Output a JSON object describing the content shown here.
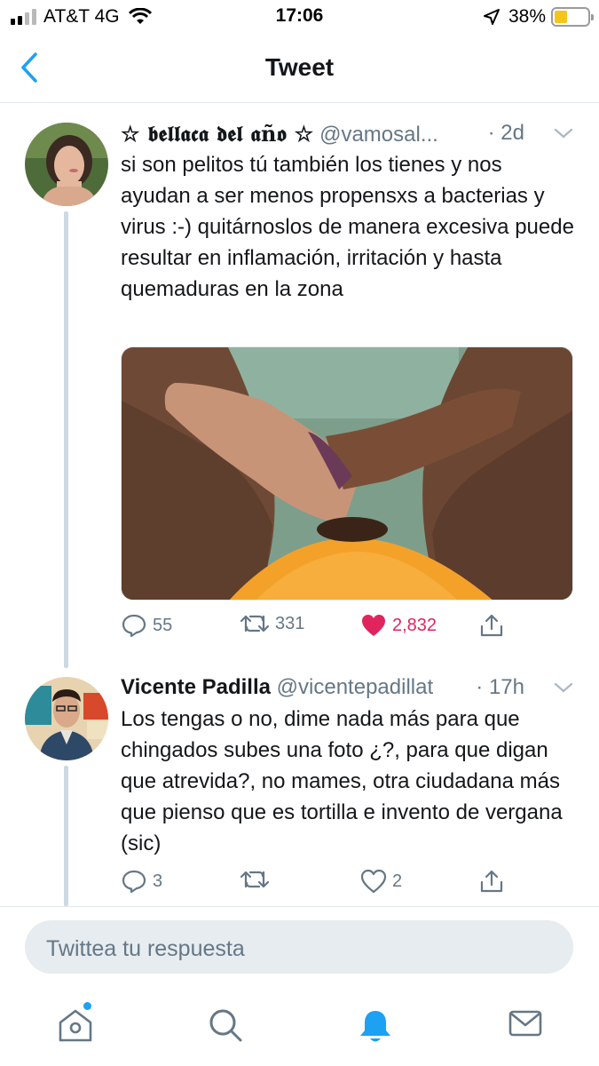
{
  "status_bar": {
    "carrier": "AT&T 4G",
    "time": "17:06",
    "battery_percent": "38%",
    "battery_level": 0.38,
    "battery_color": "#f5c518"
  },
  "nav": {
    "title": "Tweet",
    "back_icon": "chevron-left-icon"
  },
  "tweets": [
    {
      "name": "☆ 𝖇𝖊𝖑𝖑𝖆𝖈𝖆 𝖉𝖊𝖑 𝖆ñ𝖔 ☆",
      "handle": "@vamosal...",
      "time": "· 2d",
      "text": "si son pelitos tú también los tienes y nos ayudan a ser menos propensxs a bacterias y virus :-) quitárnoslos de manera excesiva puede resultar en inflamación, irritación y hasta quemaduras en la zona",
      "has_media": true,
      "reply_count": "55",
      "retweet_count": "331",
      "like_count": "2,832",
      "liked": true
    },
    {
      "name": "Vicente Padilla",
      "handle": "@vicentepadillat",
      "time": "· 17h",
      "text": "Los tengas o no, dime nada más para que chingados subes una foto ¿?, para que digan que atrevida?, no mames, otra ciudadana más que pienso que es tortilla e invento de vergana (sic)",
      "has_media": false,
      "reply_count": "3",
      "retweet_count": "",
      "like_count": "2",
      "liked": false
    }
  ],
  "reply_input": {
    "placeholder": "Twittea tu respuesta"
  },
  "tabbar": {
    "items": [
      "home-icon",
      "search-icon",
      "notifications-icon",
      "messages-icon"
    ],
    "active": "notifications-icon"
  },
  "colors": {
    "accent": "#1da1f2",
    "like": "#e0245e",
    "muted": "#657786",
    "thread_line": "#cdd9e1"
  }
}
